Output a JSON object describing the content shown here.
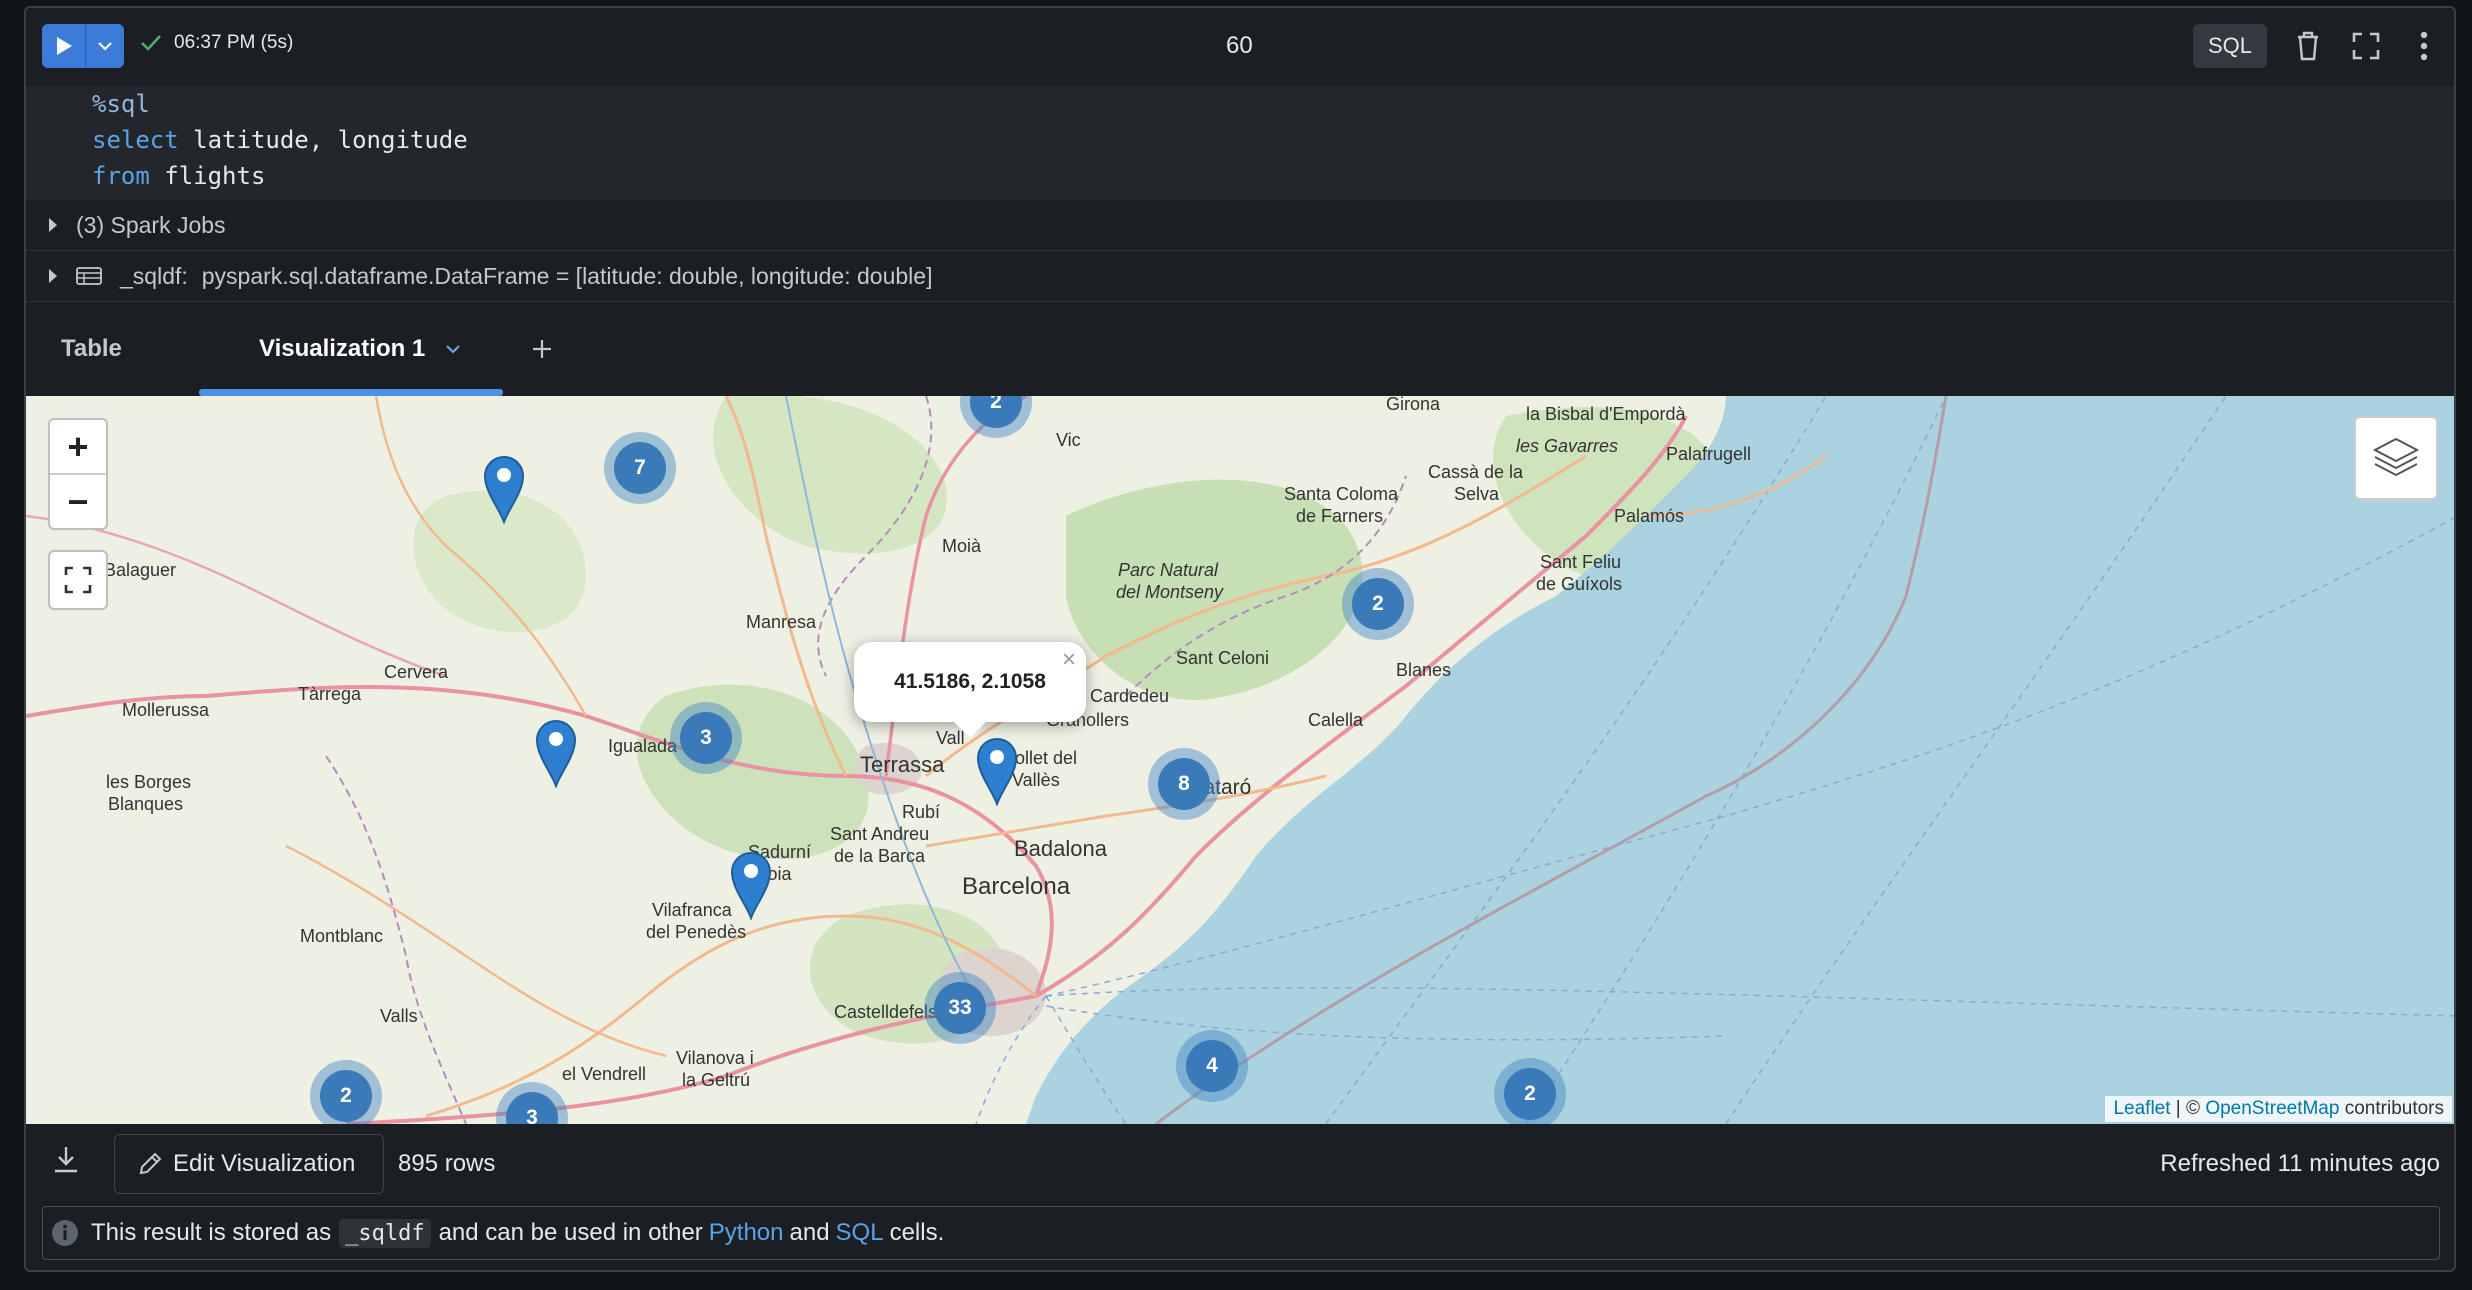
{
  "toolbar": {
    "run_label": "Run cell",
    "status_time": "06:37 PM (5s)",
    "cell_title": "60",
    "language": "SQL"
  },
  "code": {
    "lines": [
      {
        "parts": [
          {
            "text": "%sql",
            "kind": "magic"
          }
        ]
      },
      {
        "parts": [
          {
            "text": "select",
            "kind": "kw"
          },
          {
            "text": " latitude, longitude",
            "kind": "plain"
          }
        ]
      },
      {
        "parts": [
          {
            "text": "from",
            "kind": "kw"
          },
          {
            "text": " flights",
            "kind": "plain"
          }
        ]
      }
    ]
  },
  "jobs": {
    "label": "(3) Spark Jobs"
  },
  "dataframe": {
    "name": "_sqldf:",
    "schema": "pyspark.sql.dataframe.DataFrame = [latitude: double, longitude: double]"
  },
  "tabs": {
    "table_label": "Table",
    "viz_label": "Visualization 1"
  },
  "map": {
    "zoom_in": "+",
    "zoom_out": "−",
    "clusters": [
      "2",
      "7",
      "3",
      "2",
      "8",
      "33",
      "4",
      "2",
      "2",
      "3"
    ],
    "popup_text": "41.5186, 2.1058",
    "popup_close": "×",
    "place_labels": [
      "Girona",
      "Vic",
      "la Bisbal d'Empordà",
      "les Gavarres",
      "Palafrugell",
      "Santa Coloma",
      "de Farners",
      "Cassà de la",
      "Selva",
      "Palamós",
      "Moià",
      "Parc Natural",
      "del Montseny",
      "Sant Feliu",
      "de Guíxols",
      "Manresa",
      "Sant Celoni",
      "Blanes",
      "Tàrrega",
      "Cervera",
      "Cardedeu",
      "Granollers",
      "Calella",
      "Mollerussa",
      "Igualada",
      "Terrassa",
      "Mollet del",
      "Vallès",
      "Mataró",
      "les Borges",
      "Blanques",
      "Rubí",
      "Sant Andreu",
      "de la Barca",
      "Badalona",
      "Sadurní",
      "d'Anoia",
      "Barcelona",
      "Montblanc",
      "Vilafranca",
      "del Penedès",
      "Valls",
      "Castelldefels",
      "Vilanova i",
      "la Geltrú",
      "el Vendrell",
      "Balaguer",
      "Vall",
      "Terrassa"
    ],
    "attribution": {
      "leaflet": "Leaflet",
      "sep": " | © ",
      "osm": "OpenStreetMap",
      "suffix": " contributors"
    }
  },
  "footer": {
    "edit_label": "Edit Visualization",
    "row_count": "895 rows",
    "refreshed": "Refreshed 11 minutes ago"
  },
  "info": {
    "prefix": "This result is stored as",
    "var": "_sqldf",
    "middle": "and can be used in other",
    "python": "Python",
    "and": "and",
    "sql": "SQL",
    "suffix": "cells."
  }
}
